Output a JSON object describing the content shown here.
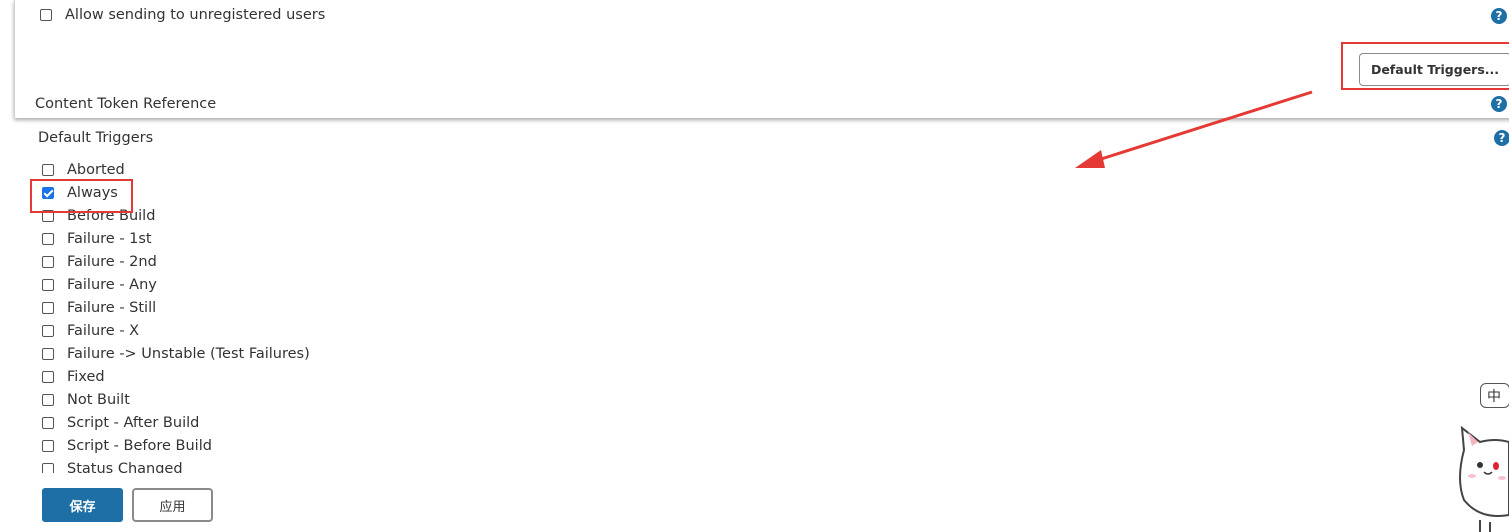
{
  "notification": {
    "allow_unregistered_label": "Allow sending to unregistered users",
    "allow_unregistered_checked": false,
    "default_triggers_button": "Default Triggers...",
    "content_token_label": "Content Token Reference"
  },
  "triggers": {
    "title": "Default Triggers",
    "items": [
      {
        "label": "Aborted",
        "checked": false
      },
      {
        "label": "Always",
        "checked": true
      },
      {
        "label": "Before Build",
        "checked": false
      },
      {
        "label": "Failure - 1st",
        "checked": false
      },
      {
        "label": "Failure - 2nd",
        "checked": false
      },
      {
        "label": "Failure - Any",
        "checked": false
      },
      {
        "label": "Failure - Still",
        "checked": false
      },
      {
        "label": "Failure - X",
        "checked": false
      },
      {
        "label": "Failure -> Unstable (Test Failures)",
        "checked": false
      },
      {
        "label": "Fixed",
        "checked": false
      },
      {
        "label": "Not Built",
        "checked": false
      },
      {
        "label": "Script - After Build",
        "checked": false
      },
      {
        "label": "Script - Before Build",
        "checked": false
      },
      {
        "label": "Status Changed",
        "checked": false
      }
    ]
  },
  "help": {
    "glyph": "?"
  },
  "footer": {
    "save_label": "保存",
    "apply_label": "应用"
  },
  "ime": {
    "label": "中"
  },
  "colors": {
    "primary": "#1d6fa5",
    "annotation": "#e53935",
    "checkbox_checked": "#1a73e8"
  }
}
